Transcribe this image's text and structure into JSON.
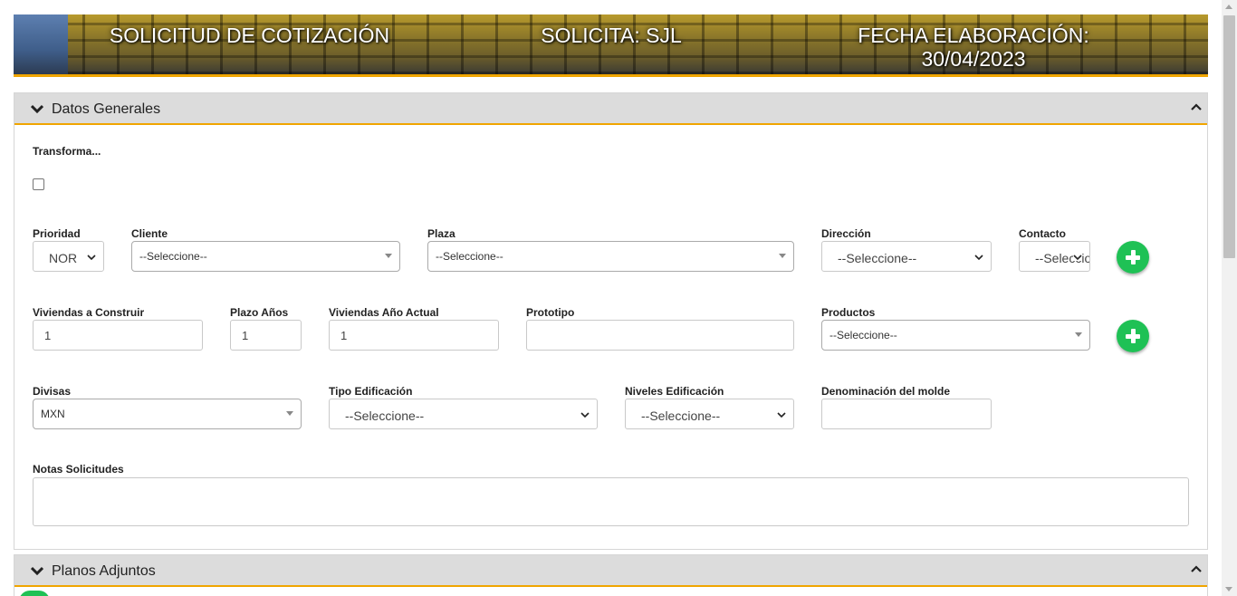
{
  "header": {
    "title": "SOLICITUD DE COTIZACIÓN",
    "solicita": "SOLICITA: SJL",
    "fecha_label": "FECHA ELABORACIÓN:",
    "fecha_value": "30/04/2023",
    "accent_color": "#f0a500"
  },
  "datos_generales": {
    "title": "Datos Generales",
    "transforma_label": "Transforma...",
    "transforma_checked": false,
    "prioridad": {
      "label": "Prioridad",
      "value": "NOR"
    },
    "cliente": {
      "label": "Cliente",
      "value": "--Seleccione--"
    },
    "plaza": {
      "label": "Plaza",
      "value": "--Seleccione--"
    },
    "direccion": {
      "label": "Dirección",
      "value": "--Seleccione--"
    },
    "contacto": {
      "label": "Contacto",
      "value": "--Seleccione--"
    },
    "viviendas_construir": {
      "label": "Viviendas a Construir",
      "value": "1"
    },
    "plazo_anios": {
      "label": "Plazo Años",
      "value": "1"
    },
    "viviendas_anio_actual": {
      "label": "Viviendas Año Actual",
      "value": "1"
    },
    "prototipo": {
      "label": "Prototipo",
      "value": ""
    },
    "productos": {
      "label": "Productos",
      "value": "--Seleccione--"
    },
    "divisas": {
      "label": "Divisas",
      "value": "MXN"
    },
    "tipo_edificacion": {
      "label": "Tipo Edificación",
      "value": "--Seleccione--"
    },
    "niveles_edificacion": {
      "label": "Niveles Edificación",
      "value": "--Seleccione--"
    },
    "denominacion_molde": {
      "label": "Denominación del molde",
      "value": ""
    },
    "notas": {
      "label": "Notas Solicitudes",
      "value": ""
    }
  },
  "planos_adjuntos": {
    "title": "Planos Adjuntos"
  },
  "colors": {
    "add_button": "#1fc155",
    "panel_header": "#dcdcdc"
  }
}
